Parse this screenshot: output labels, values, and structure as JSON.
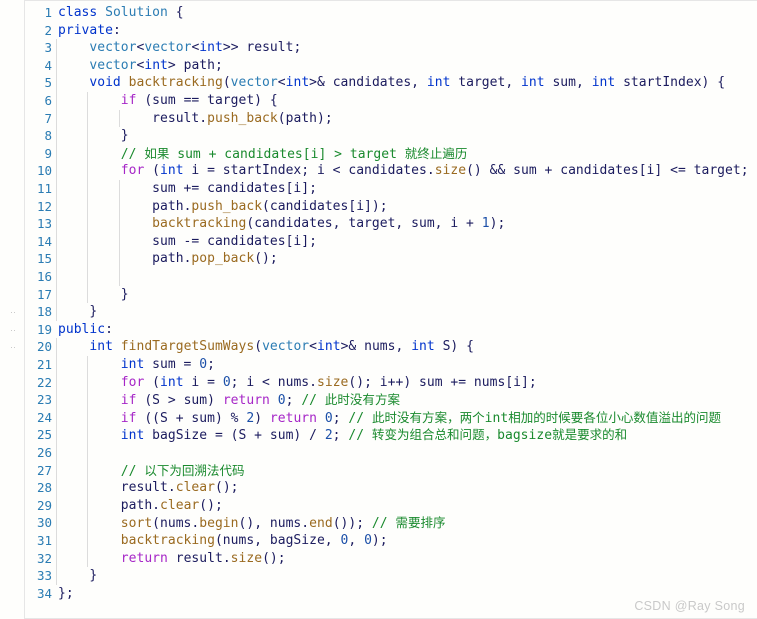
{
  "editor": {
    "background_color": "#fefefc",
    "line_number_color": "#2b7cb3",
    "first_line": 1,
    "last_line": 34,
    "total_lines": 34,
    "language": "cpp"
  },
  "palette": {
    "keyword": "#0033cc",
    "control": "#a626c7",
    "type": "#2b7cb3",
    "function": "#9a6a20",
    "identifier": "#1b1b5e",
    "number": "#1b4fa8",
    "comment": "#1a8a2e",
    "gutter": "#c8c8c8",
    "indent_guide": "#dcdcdc",
    "watermark": "#c9c9c9"
  },
  "watermark": {
    "text": "CSDN @Ray Song"
  },
  "lines": [
    {
      "n": "1",
      "dot": false,
      "guides": [],
      "tokens": [
        {
          "t": "class",
          "c": "kw"
        },
        {
          "t": " ",
          "c": "id"
        },
        {
          "t": "Solution",
          "c": "type"
        },
        {
          "t": " {",
          "c": "punct"
        }
      ]
    },
    {
      "n": "2",
      "dot": false,
      "guides": [],
      "tokens": [
        {
          "t": "private",
          "c": "kw"
        },
        {
          "t": ":",
          "c": "punct"
        }
      ]
    },
    {
      "n": "3",
      "dot": false,
      "guides": [
        0
      ],
      "tokens": [
        {
          "t": "    ",
          "c": "id"
        },
        {
          "t": "vector",
          "c": "type"
        },
        {
          "t": "<",
          "c": "punct"
        },
        {
          "t": "vector",
          "c": "type"
        },
        {
          "t": "<",
          "c": "punct"
        },
        {
          "t": "int",
          "c": "kw"
        },
        {
          "t": ">> ",
          "c": "punct"
        },
        {
          "t": "result;",
          "c": "id"
        }
      ]
    },
    {
      "n": "4",
      "dot": false,
      "guides": [
        0
      ],
      "tokens": [
        {
          "t": "    ",
          "c": "id"
        },
        {
          "t": "vector",
          "c": "type"
        },
        {
          "t": "<",
          "c": "punct"
        },
        {
          "t": "int",
          "c": "kw"
        },
        {
          "t": "> ",
          "c": "punct"
        },
        {
          "t": "path;",
          "c": "id"
        }
      ]
    },
    {
      "n": "5",
      "dot": false,
      "guides": [
        0
      ],
      "tokens": [
        {
          "t": "    ",
          "c": "id"
        },
        {
          "t": "void",
          "c": "kw"
        },
        {
          "t": " ",
          "c": "id"
        },
        {
          "t": "backtracking",
          "c": "fn"
        },
        {
          "t": "(",
          "c": "punct"
        },
        {
          "t": "vector",
          "c": "type"
        },
        {
          "t": "<",
          "c": "punct"
        },
        {
          "t": "int",
          "c": "kw"
        },
        {
          "t": ">& candidates, ",
          "c": "id"
        },
        {
          "t": "int",
          "c": "kw"
        },
        {
          "t": " target, ",
          "c": "id"
        },
        {
          "t": "int",
          "c": "kw"
        },
        {
          "t": " sum, ",
          "c": "id"
        },
        {
          "t": "int",
          "c": "kw"
        },
        {
          "t": " startIndex) {",
          "c": "id"
        }
      ]
    },
    {
      "n": "6",
      "dot": false,
      "guides": [
        0,
        1
      ],
      "tokens": [
        {
          "t": "        ",
          "c": "id"
        },
        {
          "t": "if",
          "c": "ctl"
        },
        {
          "t": " (sum == target) {",
          "c": "id"
        }
      ]
    },
    {
      "n": "7",
      "dot": false,
      "guides": [
        0,
        1,
        2
      ],
      "tokens": [
        {
          "t": "            ",
          "c": "id"
        },
        {
          "t": "result",
          "c": "id"
        },
        {
          "t": ".",
          "c": "punct"
        },
        {
          "t": "push_back",
          "c": "fn"
        },
        {
          "t": "(path);",
          "c": "id"
        }
      ]
    },
    {
      "n": "8",
      "dot": false,
      "guides": [
        0,
        1
      ],
      "tokens": [
        {
          "t": "        }",
          "c": "id"
        }
      ]
    },
    {
      "n": "9",
      "dot": false,
      "guides": [
        0,
        1
      ],
      "tokens": [
        {
          "t": "        ",
          "c": "id"
        },
        {
          "t": "// ",
          "c": "cmt"
        },
        {
          "t": "如果",
          "c": "cmt cn"
        },
        {
          "t": " sum + candidates[i] > target ",
          "c": "cmt"
        },
        {
          "t": "就终止遍历",
          "c": "cmt cn"
        }
      ]
    },
    {
      "n": "10",
      "dot": false,
      "guides": [
        0,
        1
      ],
      "tokens": [
        {
          "t": "        ",
          "c": "id"
        },
        {
          "t": "for",
          "c": "ctl"
        },
        {
          "t": " (",
          "c": "punct"
        },
        {
          "t": "int",
          "c": "kw"
        },
        {
          "t": " i = startIndex; i < candidates",
          "c": "id"
        },
        {
          "t": ".",
          "c": "punct"
        },
        {
          "t": "size",
          "c": "fn"
        },
        {
          "t": "() && sum + candidates[i] <= target; i++) {",
          "c": "id"
        }
      ]
    },
    {
      "n": "11",
      "dot": false,
      "guides": [
        0,
        1,
        2
      ],
      "tokens": [
        {
          "t": "            ",
          "c": "id"
        },
        {
          "t": "sum += candidates[i];",
          "c": "id"
        }
      ]
    },
    {
      "n": "12",
      "dot": false,
      "guides": [
        0,
        1,
        2
      ],
      "tokens": [
        {
          "t": "            ",
          "c": "id"
        },
        {
          "t": "path",
          "c": "id"
        },
        {
          "t": ".",
          "c": "punct"
        },
        {
          "t": "push_back",
          "c": "fn"
        },
        {
          "t": "(candidates[i]);",
          "c": "id"
        }
      ]
    },
    {
      "n": "13",
      "dot": false,
      "guides": [
        0,
        1,
        2
      ],
      "tokens": [
        {
          "t": "            ",
          "c": "id"
        },
        {
          "t": "backtracking",
          "c": "fn"
        },
        {
          "t": "(candidates, target, sum, i + ",
          "c": "id"
        },
        {
          "t": "1",
          "c": "num"
        },
        {
          "t": ");",
          "c": "id"
        }
      ]
    },
    {
      "n": "14",
      "dot": false,
      "guides": [
        0,
        1,
        2
      ],
      "tokens": [
        {
          "t": "            ",
          "c": "id"
        },
        {
          "t": "sum -= candidates[i];",
          "c": "id"
        }
      ]
    },
    {
      "n": "15",
      "dot": false,
      "guides": [
        0,
        1,
        2
      ],
      "tokens": [
        {
          "t": "            ",
          "c": "id"
        },
        {
          "t": "path",
          "c": "id"
        },
        {
          "t": ".",
          "c": "punct"
        },
        {
          "t": "pop_back",
          "c": "fn"
        },
        {
          "t": "();",
          "c": "id"
        }
      ]
    },
    {
      "n": "16",
      "dot": false,
      "guides": [
        0,
        1,
        2
      ],
      "tokens": []
    },
    {
      "n": "17",
      "dot": false,
      "guides": [
        0,
        1
      ],
      "tokens": [
        {
          "t": "        }",
          "c": "id"
        }
      ]
    },
    {
      "n": "18",
      "dot": true,
      "guides": [
        0
      ],
      "tokens": [
        {
          "t": "    }",
          "c": "id"
        }
      ]
    },
    {
      "n": "19",
      "dot": true,
      "guides": [],
      "tokens": [
        {
          "t": "public",
          "c": "kw"
        },
        {
          "t": ":",
          "c": "punct"
        }
      ]
    },
    {
      "n": "20",
      "dot": true,
      "guides": [
        0
      ],
      "tokens": [
        {
          "t": "    ",
          "c": "id"
        },
        {
          "t": "int",
          "c": "kw"
        },
        {
          "t": " ",
          "c": "id"
        },
        {
          "t": "findTargetSumWays",
          "c": "fn"
        },
        {
          "t": "(",
          "c": "punct"
        },
        {
          "t": "vector",
          "c": "type"
        },
        {
          "t": "<",
          "c": "punct"
        },
        {
          "t": "int",
          "c": "kw"
        },
        {
          "t": ">& nums, ",
          "c": "id"
        },
        {
          "t": "int",
          "c": "kw"
        },
        {
          "t": " S) {",
          "c": "id"
        }
      ]
    },
    {
      "n": "21",
      "dot": false,
      "guides": [
        0,
        1
      ],
      "tokens": [
        {
          "t": "        ",
          "c": "id"
        },
        {
          "t": "int",
          "c": "kw"
        },
        {
          "t": " sum = ",
          "c": "id"
        },
        {
          "t": "0",
          "c": "num"
        },
        {
          "t": ";",
          "c": "id"
        }
      ]
    },
    {
      "n": "22",
      "dot": false,
      "guides": [
        0,
        1
      ],
      "tokens": [
        {
          "t": "        ",
          "c": "id"
        },
        {
          "t": "for",
          "c": "ctl"
        },
        {
          "t": " (",
          "c": "punct"
        },
        {
          "t": "int",
          "c": "kw"
        },
        {
          "t": " i = ",
          "c": "id"
        },
        {
          "t": "0",
          "c": "num"
        },
        {
          "t": "; i < nums",
          "c": "id"
        },
        {
          "t": ".",
          "c": "punct"
        },
        {
          "t": "size",
          "c": "fn"
        },
        {
          "t": "(); i++) sum += nums[i];",
          "c": "id"
        }
      ]
    },
    {
      "n": "23",
      "dot": false,
      "guides": [
        0,
        1
      ],
      "tokens": [
        {
          "t": "        ",
          "c": "id"
        },
        {
          "t": "if",
          "c": "ctl"
        },
        {
          "t": " (S > sum) ",
          "c": "id"
        },
        {
          "t": "return",
          "c": "ctl"
        },
        {
          "t": " ",
          "c": "id"
        },
        {
          "t": "0",
          "c": "num"
        },
        {
          "t": "; ",
          "c": "id"
        },
        {
          "t": "// ",
          "c": "cmt"
        },
        {
          "t": "此时没有方案",
          "c": "cmt cn"
        }
      ]
    },
    {
      "n": "24",
      "dot": false,
      "guides": [
        0,
        1
      ],
      "tokens": [
        {
          "t": "        ",
          "c": "id"
        },
        {
          "t": "if",
          "c": "ctl"
        },
        {
          "t": " ((S + sum) % ",
          "c": "id"
        },
        {
          "t": "2",
          "c": "num"
        },
        {
          "t": ") ",
          "c": "id"
        },
        {
          "t": "return",
          "c": "ctl"
        },
        {
          "t": " ",
          "c": "id"
        },
        {
          "t": "0",
          "c": "num"
        },
        {
          "t": "; ",
          "c": "id"
        },
        {
          "t": "// ",
          "c": "cmt"
        },
        {
          "t": "此时没有方案，两个",
          "c": "cmt cn"
        },
        {
          "t": "int",
          "c": "cmt"
        },
        {
          "t": "相加的时候要各位小心数值溢出的问题",
          "c": "cmt cn"
        }
      ]
    },
    {
      "n": "25",
      "dot": false,
      "guides": [
        0,
        1
      ],
      "tokens": [
        {
          "t": "        ",
          "c": "id"
        },
        {
          "t": "int",
          "c": "kw"
        },
        {
          "t": " bagSize = (S + sum) / ",
          "c": "id"
        },
        {
          "t": "2",
          "c": "num"
        },
        {
          "t": "; ",
          "c": "id"
        },
        {
          "t": "// ",
          "c": "cmt"
        },
        {
          "t": "转变为组合总和问题，",
          "c": "cmt cn"
        },
        {
          "t": "bagsize",
          "c": "cmt"
        },
        {
          "t": "就是要求的和",
          "c": "cmt cn"
        }
      ]
    },
    {
      "n": "26",
      "dot": false,
      "guides": [
        0,
        1
      ],
      "tokens": []
    },
    {
      "n": "27",
      "dot": false,
      "guides": [
        0,
        1
      ],
      "tokens": [
        {
          "t": "        ",
          "c": "id"
        },
        {
          "t": "// ",
          "c": "cmt"
        },
        {
          "t": "以下为回溯法代码",
          "c": "cmt cn"
        }
      ]
    },
    {
      "n": "28",
      "dot": false,
      "guides": [
        0,
        1
      ],
      "tokens": [
        {
          "t": "        ",
          "c": "id"
        },
        {
          "t": "result",
          "c": "id"
        },
        {
          "t": ".",
          "c": "punct"
        },
        {
          "t": "clear",
          "c": "fn"
        },
        {
          "t": "();",
          "c": "id"
        }
      ]
    },
    {
      "n": "29",
      "dot": false,
      "guides": [
        0,
        1
      ],
      "tokens": [
        {
          "t": "        ",
          "c": "id"
        },
        {
          "t": "path",
          "c": "id"
        },
        {
          "t": ".",
          "c": "punct"
        },
        {
          "t": "clear",
          "c": "fn"
        },
        {
          "t": "();",
          "c": "id"
        }
      ]
    },
    {
      "n": "30",
      "dot": false,
      "guides": [
        0,
        1
      ],
      "tokens": [
        {
          "t": "        ",
          "c": "id"
        },
        {
          "t": "sort",
          "c": "fn"
        },
        {
          "t": "(nums",
          "c": "id"
        },
        {
          "t": ".",
          "c": "punct"
        },
        {
          "t": "begin",
          "c": "fn"
        },
        {
          "t": "(), nums",
          "c": "id"
        },
        {
          "t": ".",
          "c": "punct"
        },
        {
          "t": "end",
          "c": "fn"
        },
        {
          "t": "()); ",
          "c": "id"
        },
        {
          "t": "// ",
          "c": "cmt"
        },
        {
          "t": "需要排序",
          "c": "cmt cn"
        }
      ]
    },
    {
      "n": "31",
      "dot": false,
      "guides": [
        0,
        1
      ],
      "tokens": [
        {
          "t": "        ",
          "c": "id"
        },
        {
          "t": "backtracking",
          "c": "fn"
        },
        {
          "t": "(nums, bagSize, ",
          "c": "id"
        },
        {
          "t": "0",
          "c": "num"
        },
        {
          "t": ", ",
          "c": "id"
        },
        {
          "t": "0",
          "c": "num"
        },
        {
          "t": ");",
          "c": "id"
        }
      ]
    },
    {
      "n": "32",
      "dot": false,
      "guides": [
        0,
        1
      ],
      "tokens": [
        {
          "t": "        ",
          "c": "id"
        },
        {
          "t": "return",
          "c": "ctl"
        },
        {
          "t": " result",
          "c": "id"
        },
        {
          "t": ".",
          "c": "punct"
        },
        {
          "t": "size",
          "c": "fn"
        },
        {
          "t": "();",
          "c": "id"
        }
      ]
    },
    {
      "n": "33",
      "dot": false,
      "guides": [
        0
      ],
      "tokens": [
        {
          "t": "    }",
          "c": "id"
        }
      ]
    },
    {
      "n": "34",
      "dot": false,
      "guides": [],
      "tokens": [
        {
          "t": "};",
          "c": "id"
        }
      ]
    }
  ]
}
